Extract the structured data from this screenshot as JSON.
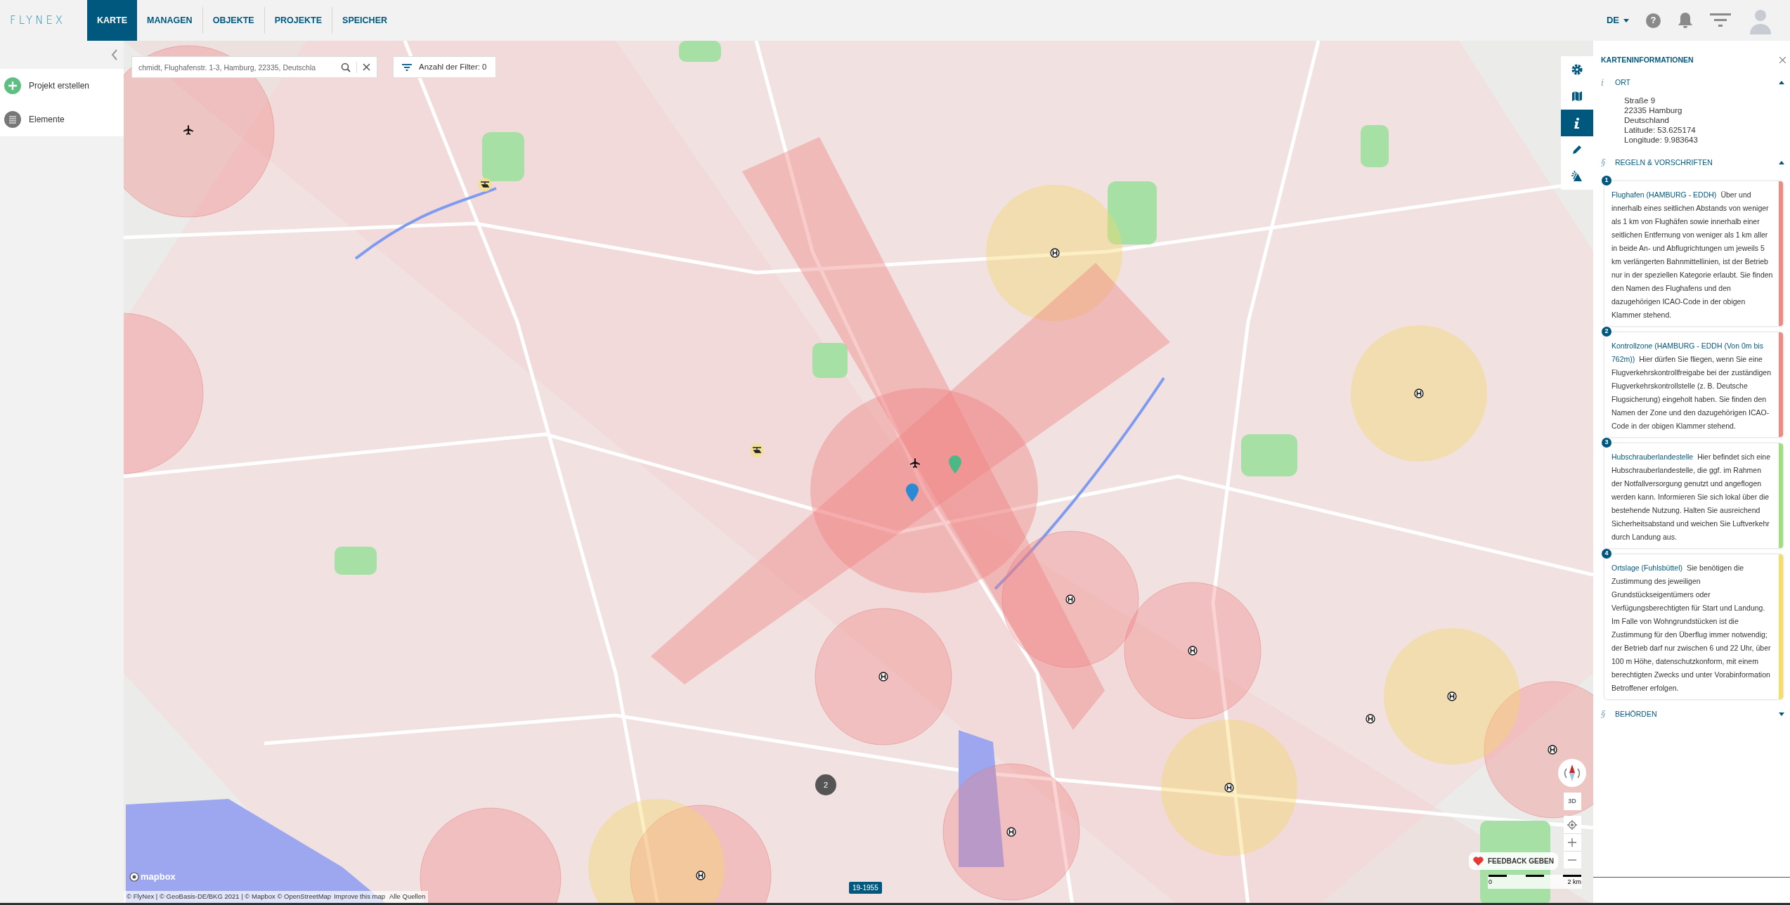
{
  "nav": {
    "logo": "FLYNEX",
    "tabs": [
      {
        "label": "KARTE",
        "selected": true
      },
      {
        "label": "MANAGEN",
        "selected": false
      },
      {
        "label": "OBJEKTE",
        "selected": false
      },
      {
        "label": "PROJEKTE",
        "selected": false
      },
      {
        "label": "SPEICHER",
        "selected": false
      }
    ],
    "language": "DE",
    "help": "?"
  },
  "sidebar": {
    "items": [
      {
        "label": "Projekt erstellen",
        "kind": "create"
      },
      {
        "label": "Elemente",
        "kind": "list"
      }
    ]
  },
  "search": {
    "value": "chmidt, Flughafenstr. 1-3, Hamburg, 22335, Deutschla"
  },
  "filter_button": "Anzahl der Filter: 0",
  "map_tools": [
    {
      "kind": "settings",
      "selected": false
    },
    {
      "kind": "map",
      "selected": false
    },
    {
      "kind": "info",
      "selected": true
    },
    {
      "kind": "edit",
      "selected": false
    },
    {
      "kind": "weather",
      "selected": false
    }
  ],
  "map": {
    "cluster": "2",
    "marker_label": "19-1955",
    "logo": "mapbox",
    "attribution": "© FlyNex | © GeoBasis-DE/BKG 2021 | © Mapbox © OpenStreetMap",
    "improve_link": "Improve this map",
    "sources_link": "Alle Quellen",
    "three_d": "3D",
    "feedback": "FEEDBACK GEBEN",
    "scale_start": "0",
    "scale_end": "2 km"
  },
  "panel": {
    "title": "KARTENINFORMATIONEN",
    "sections": [
      {
        "kind": "location",
        "symbol": "i",
        "title": "ORT",
        "expanded": true,
        "lines": [
          "Straße 9",
          "22335 Hamburg",
          "Deutschland",
          "Latitude: 53.625174",
          "Longitude: 9.983643"
        ]
      },
      {
        "kind": "rules",
        "symbol": "§",
        "title": "REGELN & VORSCHRIFTEN",
        "expanded": true,
        "rules": [
          {
            "number": "1",
            "title": "Flughafen (HAMBURG - EDDH)",
            "text": "Über und innerhalb eines seitlichen Abstands von weniger als 1 km von Flughäfen sowie innerhalb einer seitlichen Entfernung von weniger als 1 km aller in beide An- und Abflugrichtungen um jeweils 5 km verlängerten Bahnmittellinien, ist der Betrieb nur in der speziellen Kategorie erlaubt. Sie finden den Namen des Flughafens und den dazugehörigen ICAO-Code in der obigen Klammer stehend.",
            "color": "#f28a84"
          },
          {
            "number": "2",
            "title": "Kontrollzone (HAMBURG - EDDH (Von 0m bis 762m))",
            "text": "Hier dürfen Sie fliegen, wenn Sie eine Flugverkehrskontrollfreigabe bei der zuständigen Flugverkehrskontrollstelle (z. B. Deutsche Flugsicherung) eingeholt haben. Sie finden den Namen der Zone und den dazugehörigen ICAO-Code in der obigen Klammer stehend.",
            "color": "#f28a84"
          },
          {
            "number": "3",
            "title": "Hubschrauberlandestelle",
            "text": "Hier befindet sich eine Hubschrauberlandestelle, die ggf. im Rahmen der Notfallversorgung genutzt und angeflogen werden kann. Informieren Sie sich lokal über die bestehende Nutzung. Halten Sie ausreichend Sicherheitsabstand und weichen Sie Luftverkehr durch Landung aus.",
            "color": "#9fe07e"
          },
          {
            "number": "4",
            "title": "Ortslage (Fuhlsbüttel)",
            "text": "Sie benötigen die Zustimmung des jeweiligen Grundstückseigentümers oder Verfügungsberechtigten für Start und Landung. Im Falle von Wohngrundstücken ist die Zustimmung für den Überflug immer notwendig; der Betrieb darf nur zwischen 6 und 22 Uhr, über 100 m Höhe, datenschutzkonform, mit einem berechtigten Zwecks und unter Vorabinformation Betroffener erfolgen.",
            "color": "#f8dc64"
          }
        ]
      },
      {
        "kind": "authorities",
        "symbol": "§",
        "title": "BEHÖRDEN",
        "expanded": false
      }
    ]
  }
}
